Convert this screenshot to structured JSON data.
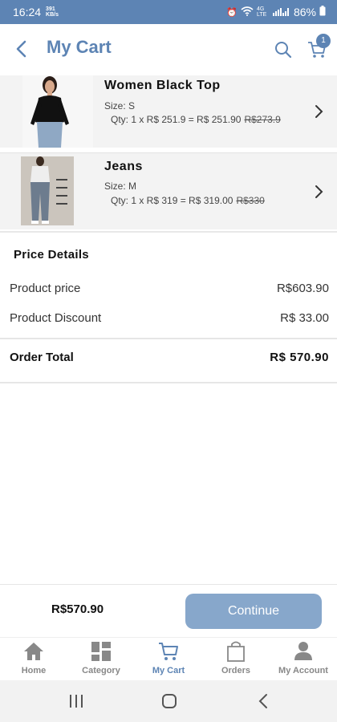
{
  "status": {
    "time": "16:24",
    "left_icon_text": "391 KB/s",
    "network": "4G LTE",
    "battery": "86%"
  },
  "header": {
    "title": "My Cart",
    "cart_count": "1"
  },
  "items": [
    {
      "name": "Women Black Top",
      "size": "Size: S",
      "qty_line": "Qty: 1 x R$ 251.9 = R$ 251.90",
      "old_price": "R$273.9"
    },
    {
      "name": "Jeans",
      "size": "Size: M",
      "qty_line": "Qty: 1 x R$ 319 = R$ 319.00",
      "old_price": "R$330"
    }
  ],
  "price_details": {
    "title": "Price Details",
    "product_price_label": "Product price",
    "product_price_value": "R$603.90",
    "discount_label": "Product Discount",
    "discount_value": "R$ 33.00",
    "order_total_label": "Order Total",
    "order_total_value": "R$  570.90"
  },
  "footer": {
    "total": "R$570.90",
    "continue_label": "Continue"
  },
  "nav": [
    {
      "label": "Home"
    },
    {
      "label": "Category"
    },
    {
      "label": "My Cart"
    },
    {
      "label": "Orders"
    },
    {
      "label": "My Account"
    }
  ],
  "colors": {
    "primary": "#5d84b4",
    "button": "#87a7cb",
    "inactive": "#888888"
  }
}
